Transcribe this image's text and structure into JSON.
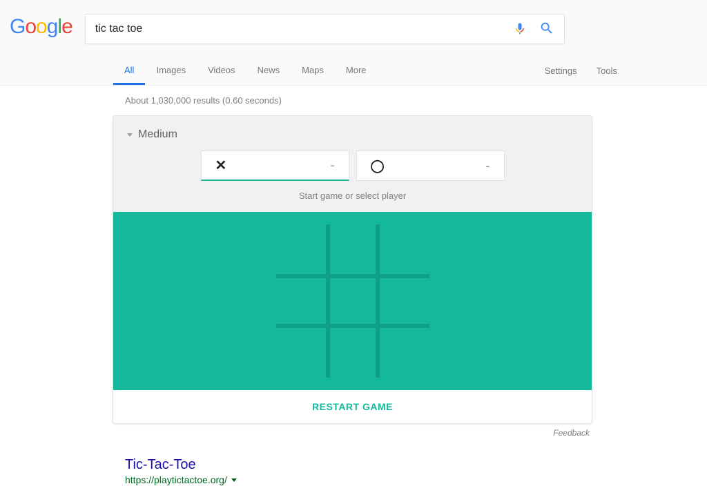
{
  "search": {
    "query": "tic tac toe"
  },
  "nav": {
    "items": [
      "All",
      "Images",
      "Videos",
      "News",
      "Maps",
      "More"
    ],
    "active_index": 0,
    "right": [
      "Settings",
      "Tools"
    ]
  },
  "results_info": "About 1,030,000 results (0.60 seconds)",
  "game": {
    "difficulty": "Medium",
    "hint": "Start game or select player",
    "player_x": {
      "symbol": "✕",
      "score": "-"
    },
    "player_o": {
      "symbol": "◯",
      "score": "-"
    },
    "restart_label": "RESTART GAME",
    "board": [
      [
        "",
        "",
        ""
      ],
      [
        "",
        "",
        ""
      ],
      [
        "",
        "",
        ""
      ]
    ]
  },
  "feedback_label": "Feedback",
  "organic": {
    "title": "Tic-Tac-Toe",
    "url": "https://playtictactoe.org/"
  },
  "colors": {
    "board_bg": "#16b89c",
    "grid": "#0e9e85",
    "accent": "#1a73e8",
    "link": "#1a0dab",
    "url": "#006621"
  }
}
